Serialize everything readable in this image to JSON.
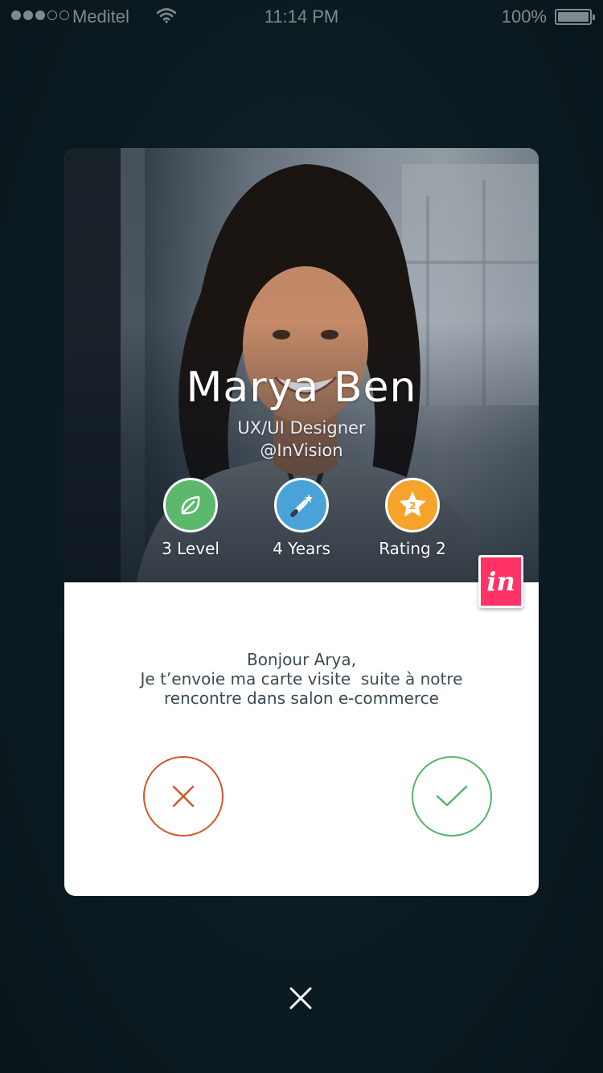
{
  "status_bar": {
    "carrier": "Meditel",
    "time": "11:14 PM",
    "battery": "100%",
    "signal_bars_filled": 3,
    "signal_bars_total": 5
  },
  "profile": {
    "name": "Marya Ben",
    "role": "UX/UI Designer",
    "company": "@InVision",
    "stats": [
      {
        "label": "3 Level",
        "icon": "leaf-icon",
        "color": "#5bb86c"
      },
      {
        "label": "4 Years",
        "icon": "magic-wand-icon",
        "color": "#4aa3d8"
      },
      {
        "label": "Rating 2",
        "icon": "star-icon",
        "badge_number": "2",
        "color": "#f5a32a"
      }
    ],
    "badge_logo": "in"
  },
  "message": {
    "line1": "Bonjour Arya,",
    "line2": "Je t’envoie ma carte visite  suite à notre",
    "line3": "rencontre dans salon e-commerce"
  },
  "actions": {
    "decline_icon": "close-icon",
    "accept_icon": "check-icon",
    "decline_color": "#d2572a",
    "accept_color": "#55b46b"
  },
  "close_icon": "close-icon"
}
